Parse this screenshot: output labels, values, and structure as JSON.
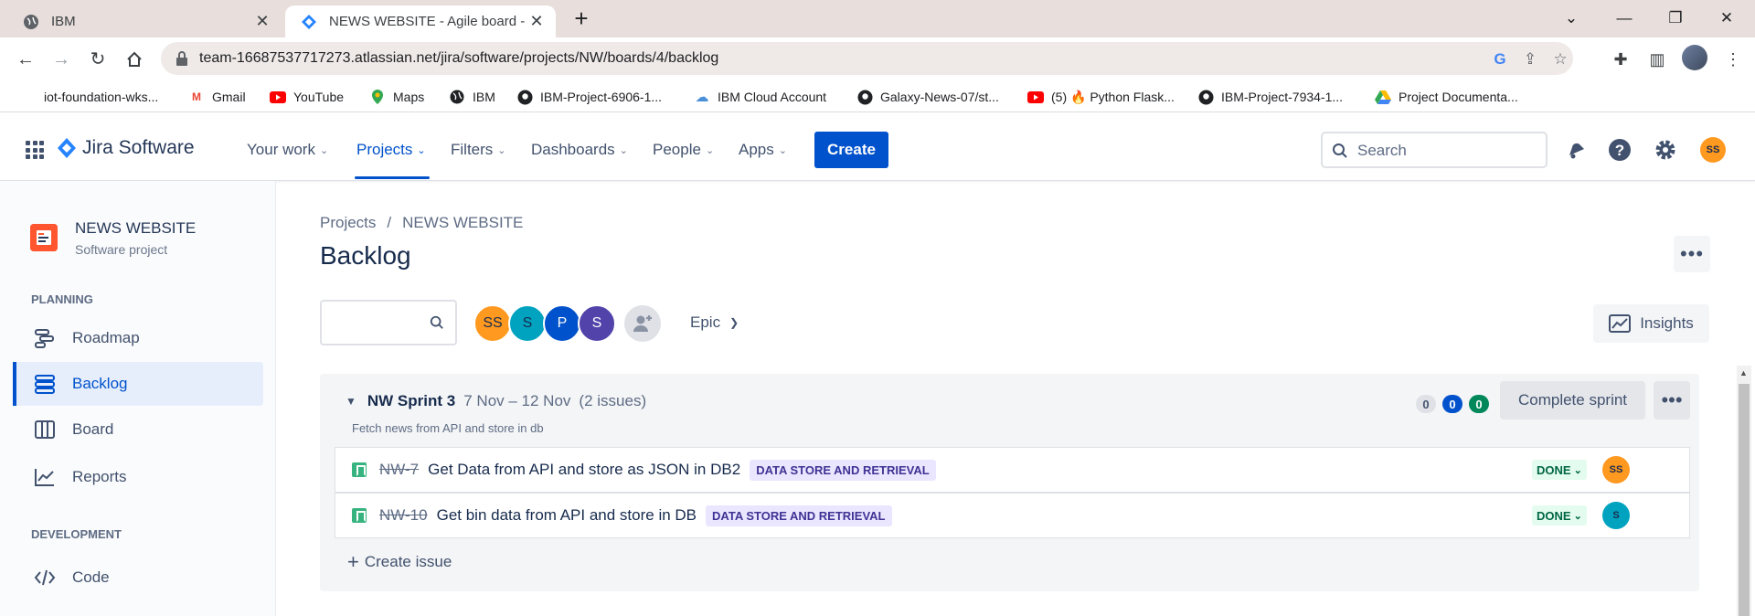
{
  "browser": {
    "tabs": [
      {
        "title": "IBM",
        "active": false
      },
      {
        "title": "NEWS WEBSITE - Agile board - Ji",
        "active": true
      }
    ],
    "url": "team-16687537717273.atlassian.net/jira/software/projects/NW/boards/4/backlog",
    "bookmarks": [
      {
        "label": "iot-foundation-wks...",
        "icon": "blank-page-icon"
      },
      {
        "label": "Gmail",
        "icon": "gmail-icon"
      },
      {
        "label": "YouTube",
        "icon": "youtube-icon"
      },
      {
        "label": "Maps",
        "icon": "maps-icon"
      },
      {
        "label": "IBM",
        "icon": "globe-icon"
      },
      {
        "label": "IBM-Project-6906-1...",
        "icon": "github-icon"
      },
      {
        "label": "IBM Cloud Account",
        "icon": "cloud-icon"
      },
      {
        "label": "Galaxy-News-07/st...",
        "icon": "github-icon"
      },
      {
        "label": "(5) 🔥 Python Flask...",
        "icon": "youtube-icon"
      },
      {
        "label": "IBM-Project-7934-1...",
        "icon": "github-icon"
      },
      {
        "label": "Project Documenta...",
        "icon": "google-drive-icon"
      }
    ]
  },
  "jira": {
    "product": "Jira Software",
    "nav": [
      "Your work",
      "Projects",
      "Filters",
      "Dashboards",
      "People",
      "Apps"
    ],
    "active_nav": "Projects",
    "create_label": "Create",
    "search_placeholder": "Search",
    "user_initials": "SS",
    "colors": {
      "brand": "#0052cc",
      "epic_bg": "#eae6ff",
      "epic_text": "#403294",
      "done_bg": "#e3fcef",
      "done_text": "#006644"
    }
  },
  "sidebar": {
    "project_name": "NEWS WEBSITE",
    "project_type": "Software project",
    "planning_label": "PLANNING",
    "planning_items": [
      "Roadmap",
      "Backlog",
      "Board",
      "Reports"
    ],
    "active_item": "Backlog",
    "development_label": "DEVELOPMENT",
    "development_items": [
      "Code"
    ]
  },
  "main": {
    "breadcrumb": [
      "Projects",
      "/",
      "NEWS WEBSITE"
    ],
    "title": "Backlog",
    "avatars": [
      {
        "initials": "SS",
        "color": "#ff991f"
      },
      {
        "initials": "S",
        "color": "#00a3bf"
      },
      {
        "initials": "P",
        "color": "#0052cc"
      },
      {
        "initials": "S",
        "color": "#5243aa"
      }
    ],
    "epic_filter": "Epic",
    "insights_label": "Insights",
    "sprint": {
      "name": "NW Sprint 3",
      "dates": "7 Nov – 12 Nov",
      "issue_count": "(2 issues)",
      "goal": "Fetch news from API and store in db",
      "counts": {
        "todo": "0",
        "in_progress": "0",
        "done": "0"
      },
      "complete_label": "Complete sprint",
      "issues": [
        {
          "key": "NW-7",
          "summary": "Get Data from API and store as JSON in DB2",
          "epic": "DATA STORE AND RETRIEVAL",
          "status": "DONE",
          "assignee": "SS",
          "assignee_color": "#ff991f"
        },
        {
          "key": "NW-10",
          "summary": "Get bin data from API and store in DB",
          "epic": "DATA STORE AND RETRIEVAL",
          "status": "DONE",
          "assignee": "S",
          "assignee_color": "#00a3bf"
        }
      ],
      "create_issue_label": "Create issue"
    }
  }
}
